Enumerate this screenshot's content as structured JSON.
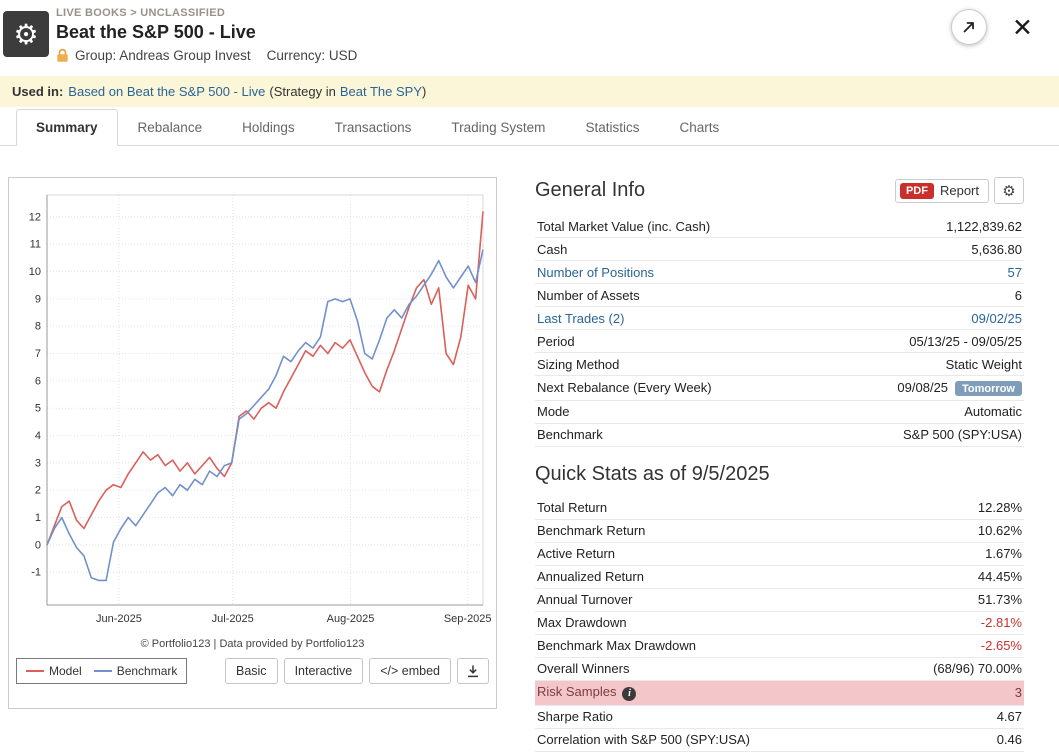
{
  "header": {
    "breadcrumb": "LIVE BOOKS > UNCLASSIFIED",
    "title": "Beat the S&P 500 - Live",
    "group_label": "Group: Andreas Group Invest",
    "currency_label": "Currency: USD"
  },
  "notice": {
    "label": "Used in:",
    "link1": "Based on Beat the S&P 500 - Live",
    "mid": "(Strategy in",
    "link2": "Beat The SPY",
    "end": ")"
  },
  "tabs": [
    {
      "label": "Summary",
      "active": true
    },
    {
      "label": "Rebalance",
      "active": false
    },
    {
      "label": "Holdings",
      "active": false
    },
    {
      "label": "Transactions",
      "active": false
    },
    {
      "label": "Trading System",
      "active": false
    },
    {
      "label": "Statistics",
      "active": false
    },
    {
      "label": "Charts",
      "active": false
    }
  ],
  "chart_card": {
    "caption": "© Portfolio123 | Data provided by Portfolio123",
    "legend": [
      {
        "label": "Model",
        "color": "#db5f5b"
      },
      {
        "label": "Benchmark",
        "color": "#7191ca"
      }
    ],
    "buttons": [
      "Basic",
      "Interactive",
      "</> embed"
    ]
  },
  "chart_data": {
    "type": "line",
    "title": "",
    "xlabel": "",
    "ylabel": "",
    "ylim": [
      -2.2,
      12.8
    ],
    "yticks": [
      -1,
      0,
      1,
      2,
      3,
      4,
      5,
      6,
      7,
      8,
      9,
      10,
      11,
      12
    ],
    "x_ticks": [
      {
        "t": 0.165,
        "label": "Jun-2025"
      },
      {
        "t": 0.426,
        "label": "Jul-2025"
      },
      {
        "t": 0.696,
        "label": "Aug-2025"
      },
      {
        "t": 0.965,
        "label": "Sep-2025"
      }
    ],
    "series": [
      {
        "name": "Model",
        "color": "#db5f5b",
        "values": [
          0,
          0.7,
          1.4,
          1.6,
          0.9,
          0.6,
          1.1,
          1.6,
          2.0,
          2.2,
          2.1,
          2.6,
          3.0,
          3.4,
          3.1,
          3.3,
          2.9,
          3.1,
          2.7,
          3.0,
          2.6,
          2.9,
          3.2,
          2.8,
          2.5,
          3.0,
          4.7,
          4.9,
          4.6,
          5.0,
          5.2,
          5.0,
          5.6,
          6.1,
          6.6,
          7.1,
          6.9,
          7.3,
          7.0,
          7.4,
          7.2,
          7.5,
          6.9,
          6.3,
          5.8,
          5.6,
          6.4,
          7.1,
          7.9,
          8.7,
          9.4,
          9.7,
          8.8,
          9.4,
          7.0,
          6.6,
          7.6,
          9.5,
          9.0,
          12.2
        ]
      },
      {
        "name": "Benchmark",
        "color": "#7191ca",
        "values": [
          0,
          0.6,
          1.0,
          0.4,
          -0.1,
          -0.4,
          -1.2,
          -1.3,
          -1.3,
          0.1,
          0.6,
          1.0,
          0.7,
          1.1,
          1.5,
          1.9,
          2.1,
          1.8,
          2.2,
          2.0,
          2.4,
          2.2,
          2.7,
          2.5,
          2.9,
          3.0,
          4.6,
          4.8,
          5.1,
          5.4,
          5.7,
          6.2,
          6.9,
          6.7,
          7.1,
          7.4,
          7.2,
          7.6,
          8.9,
          9.0,
          8.9,
          9.0,
          8.2,
          7.0,
          6.8,
          7.5,
          8.3,
          8.6,
          8.3,
          8.8,
          9.1,
          9.5,
          9.9,
          10.4,
          9.8,
          9.4,
          9.8,
          10.2,
          9.6,
          10.8
        ]
      }
    ]
  },
  "general_info": {
    "title": "General Info",
    "pdf_label": "PDF",
    "report_label": "Report",
    "rows": [
      {
        "label": "Total Market Value (inc. Cash)",
        "value": "1,122,839.62"
      },
      {
        "label": "Cash",
        "value": "5,636.80"
      },
      {
        "label": "Number of Positions",
        "value": "57",
        "link": true
      },
      {
        "label": "Number of Assets",
        "value": "6"
      },
      {
        "label": "Last Trades (2)",
        "value": "09/02/25",
        "link": true
      },
      {
        "label": "Period",
        "value": "05/13/25 - 09/05/25"
      },
      {
        "label": "Sizing Method",
        "value": "Static Weight"
      },
      {
        "label": "Next Rebalance (Every Week)",
        "value": "09/08/25",
        "badge": "Tomorrow"
      },
      {
        "label": "Mode",
        "value": "Automatic"
      },
      {
        "label": "Benchmark",
        "value": "S&P 500 (SPY:USA)"
      }
    ]
  },
  "quick_stats": {
    "title": "Quick Stats as of 9/5/2025",
    "rows": [
      {
        "label": "Total Return",
        "value": "12.28%"
      },
      {
        "label": "Benchmark Return",
        "value": "10.62%"
      },
      {
        "label": "Active Return",
        "value": "1.67%"
      },
      {
        "label": "Annualized Return",
        "value": "44.45%"
      },
      {
        "label": "Annual Turnover",
        "value": "51.73%"
      },
      {
        "label": "Max Drawdown",
        "value": "-2.81%",
        "negative": true
      },
      {
        "label": "Benchmark Max Drawdown",
        "value": "-2.65%",
        "negative": true
      },
      {
        "label": "Overall Winners",
        "value": "(68/96) 70.00%"
      },
      {
        "label": "Risk Samples",
        "value": "3",
        "highlight": true,
        "info": true
      },
      {
        "label": "Sharpe Ratio",
        "value": "4.67"
      },
      {
        "label": "Correlation with S&P 500 (SPY:USA)",
        "value": "0.46"
      }
    ]
  }
}
